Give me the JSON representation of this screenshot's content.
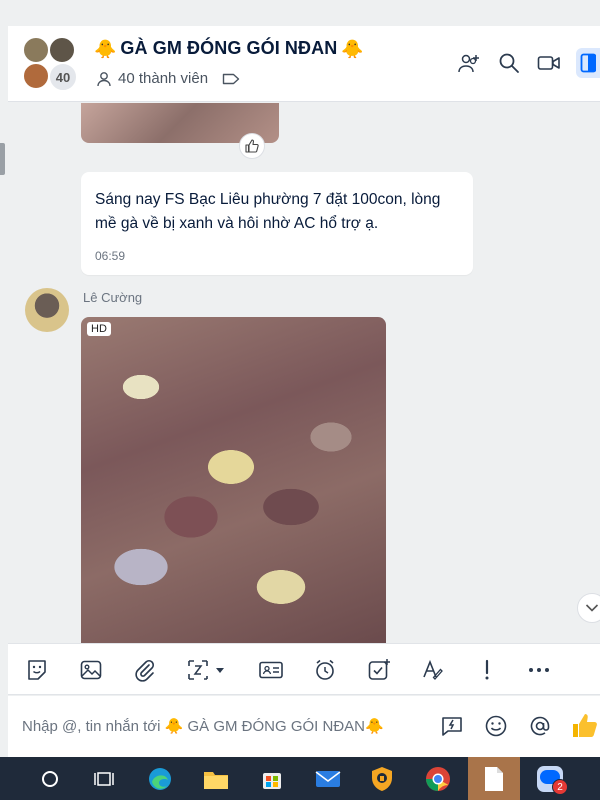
{
  "header": {
    "title": "GÀ GM ĐÓNG GÓI NĐAN",
    "title_prefix_emoji": "🐥",
    "title_suffix_emoji": "🐥",
    "member_count_avatar": "40",
    "members_text": "40 thành viên",
    "icons": [
      "add-member-icon",
      "search-icon",
      "video-call-icon",
      "sidebar-toggle-icon"
    ]
  },
  "messages": {
    "text_message": {
      "text": "Sáng nay FS Bạc Liêu phường 7 đặt 100con, lòng mề gà về bị xanh và hôi nhờ AC hổ trợ ạ.",
      "time": "06:59"
    },
    "photo_message": {
      "sender": "Lê Cường",
      "quality_badge": "HD"
    }
  },
  "toolbar": {
    "icons": [
      "sticker-icon",
      "image-icon",
      "attachment-icon",
      "screenshot-icon",
      "contact-card-icon",
      "reminder-icon",
      "task-icon",
      "text-format-icon",
      "important-icon",
      "more-icon"
    ]
  },
  "input": {
    "placeholder": "Nhập @, tin nhắn tới 🐥 GÀ GM ĐÓNG GÓI NĐAN🐥"
  },
  "taskbar": {
    "zalo_badge": "2",
    "zalo_label": "Za"
  },
  "colors": {
    "accent": "#0068ff",
    "background": "#eef0f1",
    "taskbar": "#1f2a3a",
    "badge": "#e53935"
  }
}
